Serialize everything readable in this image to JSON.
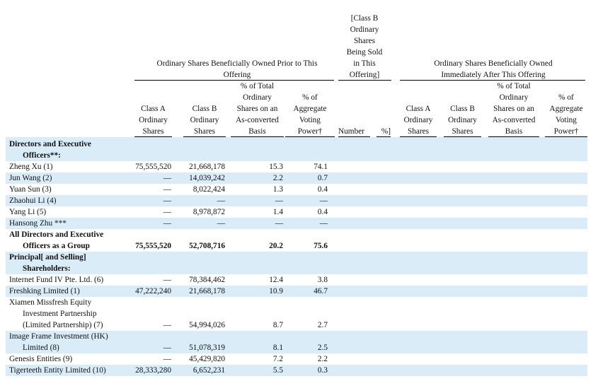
{
  "header": {
    "prior_group": "Ordinary Shares Beneficially Owned Prior to This Offering",
    "class_b_sold_lines": [
      "[Class B",
      "Ordinary",
      "Shares",
      "Being Sold",
      "in This",
      "Offering]"
    ],
    "after_group": "Ordinary Shares Beneficially Owned Immediately After This Offering",
    "prior_cols": [
      {
        "lines": [
          "Class A",
          "Ordinary",
          "Shares"
        ]
      },
      {
        "lines": [
          "Class B",
          "Ordinary",
          "Shares"
        ]
      },
      {
        "lines": [
          "% of Total",
          "Ordinary",
          "Shares on an",
          "As-converted",
          "Basis"
        ]
      },
      {
        "lines": [
          "% of",
          "Aggregate",
          "Voting",
          "Power†"
        ]
      }
    ],
    "number_label": "Number",
    "percent_label": "%]",
    "after_cols": [
      {
        "lines": [
          "Class A",
          "Ordinary",
          "Shares"
        ]
      },
      {
        "lines": [
          "Class B",
          "Ordinary",
          "Shares"
        ]
      },
      {
        "lines": [
          "% of Total",
          "Ordinary",
          "Shares on an",
          "As-converted",
          "Basis"
        ]
      },
      {
        "lines": [
          "% of",
          "Aggregate",
          "Voting",
          "Power†"
        ]
      }
    ]
  },
  "rows": [
    {
      "label": "Directors and Executive",
      "bold": true,
      "shaded": true
    },
    {
      "label": "Officers**:",
      "bold": true,
      "shaded": true,
      "sub": true
    },
    {
      "label": "Zheng Xu (1)",
      "a": "75,555,520",
      "b": "21,668,178",
      "pct": "15.3",
      "vote": "74.1"
    },
    {
      "label": "Jun Wang (2)",
      "a": "—",
      "b": "14,039,242",
      "pct": "2.2",
      "vote": "0.7",
      "shaded": true
    },
    {
      "label": "Yuan Sun (3)",
      "a": "—",
      "b": "8,022,424",
      "pct": "1.3",
      "vote": "0.4"
    },
    {
      "label": "Zhaohui Li (4)",
      "a": "—",
      "b": "—",
      "pct": "—",
      "vote": "—",
      "shaded": true
    },
    {
      "label": "Yang Li (5)",
      "a": "—",
      "b": "8,978,872",
      "pct": "1.4",
      "vote": "0.4"
    },
    {
      "label": "Hansong Zhu ***",
      "a": "—",
      "b": "—",
      "pct": "—",
      "vote": "—",
      "shaded": true
    },
    {
      "label": "All Directors and Executive",
      "bold": true
    },
    {
      "label": "Officers as a Group",
      "bold": true,
      "sub": true,
      "a": "75,555,520",
      "b": "52,708,716",
      "pct": "20.2",
      "vote": "75.6"
    },
    {
      "label": "Principal[ and Selling]",
      "bold": true,
      "shaded": true
    },
    {
      "label": "Shareholders:",
      "bold": true,
      "shaded": true,
      "sub": true
    },
    {
      "label": "Internet Fund IV Pte. Ltd. (6)",
      "a": "—",
      "b": "78,384,462",
      "pct": "12.4",
      "vote": "3.8"
    },
    {
      "label": "Freshking Limited (1)",
      "a": "47,222,240",
      "b": "21,668,178",
      "pct": "10.9",
      "vote": "46.7",
      "shaded": true
    },
    {
      "label": "Xiamen Missfresh Equity"
    },
    {
      "label": "Investment Partnership",
      "sub": true
    },
    {
      "label": "(Limited Partnership) (7)",
      "sub": true,
      "a": "—",
      "b": "54,994,026",
      "pct": "8.7",
      "vote": "2.7"
    },
    {
      "label": "Image Frame Investment (HK)",
      "shaded": true
    },
    {
      "label": "Limited (8)",
      "shaded": true,
      "sub": true,
      "a": "—",
      "b": "51,078,319",
      "pct": "8.1",
      "vote": "2.5"
    },
    {
      "label": "Genesis Entities (9)",
      "a": "—",
      "b": "45,429,820",
      "pct": "7.2",
      "vote": "2.2"
    },
    {
      "label": "Tigerteeth Entity Limited (10)",
      "a": "28,333,280",
      "b": "6,652,231",
      "pct": "5.5",
      "vote": "0.3",
      "shaded": true
    }
  ]
}
